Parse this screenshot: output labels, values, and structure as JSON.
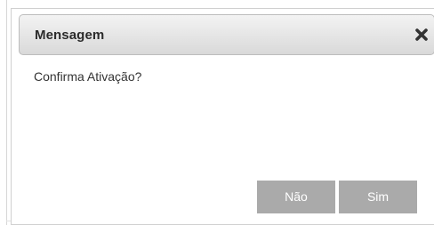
{
  "dialog": {
    "title": "Mensagem",
    "close_icon": "close-icon",
    "message": "Confirma Ativação?",
    "buttons": {
      "no_label": "Não",
      "yes_label": "Sim"
    }
  },
  "colors": {
    "button_bg": "#aaaaaa",
    "button_text": "#ffffff",
    "header_gradient_top": "#f3f3f3",
    "header_gradient_bottom": "#d9d9d9",
    "title_text": "#2b2b2b"
  }
}
